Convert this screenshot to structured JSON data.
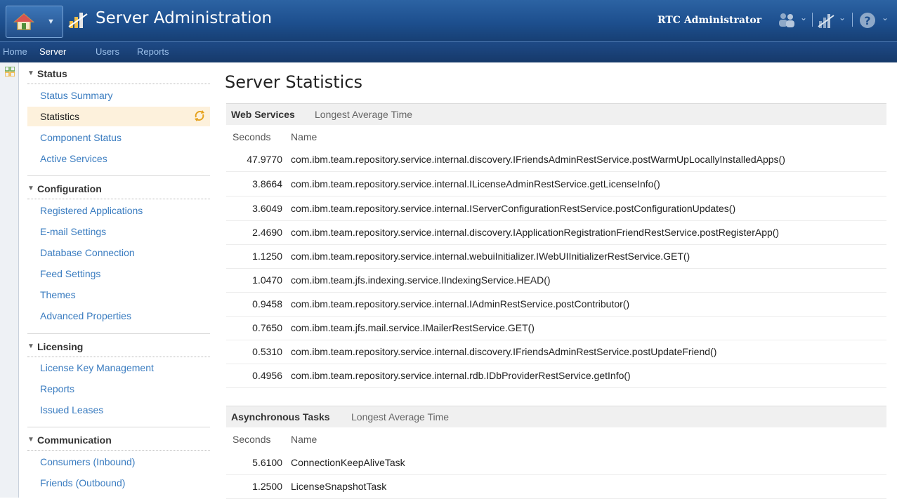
{
  "header": {
    "app_title": "Server Administration",
    "user_name": "RTC Administrator"
  },
  "nav": {
    "items": [
      "Home",
      "Server",
      "Users",
      "Reports"
    ],
    "active": "Server"
  },
  "sidebar": {
    "sections": [
      {
        "title": "Status",
        "items": [
          "Status Summary",
          "Statistics",
          "Component Status",
          "Active Services"
        ]
      },
      {
        "title": "Configuration",
        "items": [
          "Registered Applications",
          "E-mail Settings",
          "Database Connection",
          "Feed Settings",
          "Themes",
          "Advanced Properties"
        ]
      },
      {
        "title": "Licensing",
        "items": [
          "License Key Management",
          "Reports",
          "Issued Leases"
        ]
      },
      {
        "title": "Communication",
        "items": [
          "Consumers (Inbound)",
          "Friends (Outbound)"
        ]
      }
    ],
    "selected": "Statistics"
  },
  "main": {
    "title": "Server Statistics",
    "groups": [
      {
        "title": "Web Services",
        "subtitle": "Longest Average Time",
        "columns": [
          "Seconds",
          "Name"
        ],
        "rows": [
          [
            "47.9770",
            "com.ibm.team.repository.service.internal.discovery.IFriendsAdminRestService.postWarmUpLocallyInstalledApps()"
          ],
          [
            "3.8664",
            "com.ibm.team.repository.service.internal.ILicenseAdminRestService.getLicenseInfo()"
          ],
          [
            "3.6049",
            "com.ibm.team.repository.service.internal.IServerConfigurationRestService.postConfigurationUpdates()"
          ],
          [
            "2.4690",
            "com.ibm.team.repository.service.internal.discovery.IApplicationRegistrationFriendRestService.postRegisterApp()"
          ],
          [
            "1.1250",
            "com.ibm.team.repository.service.internal.webuiInitializer.IWebUIInitializerRestService.GET()"
          ],
          [
            "1.0470",
            "com.ibm.team.jfs.indexing.service.IIndexingService.HEAD()"
          ],
          [
            "0.9458",
            "com.ibm.team.repository.service.internal.IAdminRestService.postContributor()"
          ],
          [
            "0.7650",
            "com.ibm.team.jfs.mail.service.IMailerRestService.GET()"
          ],
          [
            "0.5310",
            "com.ibm.team.repository.service.internal.discovery.IFriendsAdminRestService.postUpdateFriend()"
          ],
          [
            "0.4956",
            "com.ibm.team.repository.service.internal.rdb.IDbProviderRestService.getInfo()"
          ]
        ]
      },
      {
        "title": "Asynchronous Tasks",
        "subtitle": "Longest Average Time",
        "columns": [
          "Seconds",
          "Name"
        ],
        "rows": [
          [
            "5.6100",
            "ConnectionKeepAliveTask"
          ],
          [
            "1.2500",
            "LicenseSnapshotTask"
          ]
        ]
      }
    ]
  },
  "icons": {
    "home": "home-icon",
    "app": "server-admin-icon",
    "users": "users-icon",
    "tools": "tools-icon",
    "help": "help-icon",
    "refresh": "refresh-icon",
    "rail": "grid-icon"
  },
  "colors": {
    "titlebar": "#1d4f8e",
    "link": "#3a7cc0",
    "selected_bg": "#fdf1dc"
  }
}
